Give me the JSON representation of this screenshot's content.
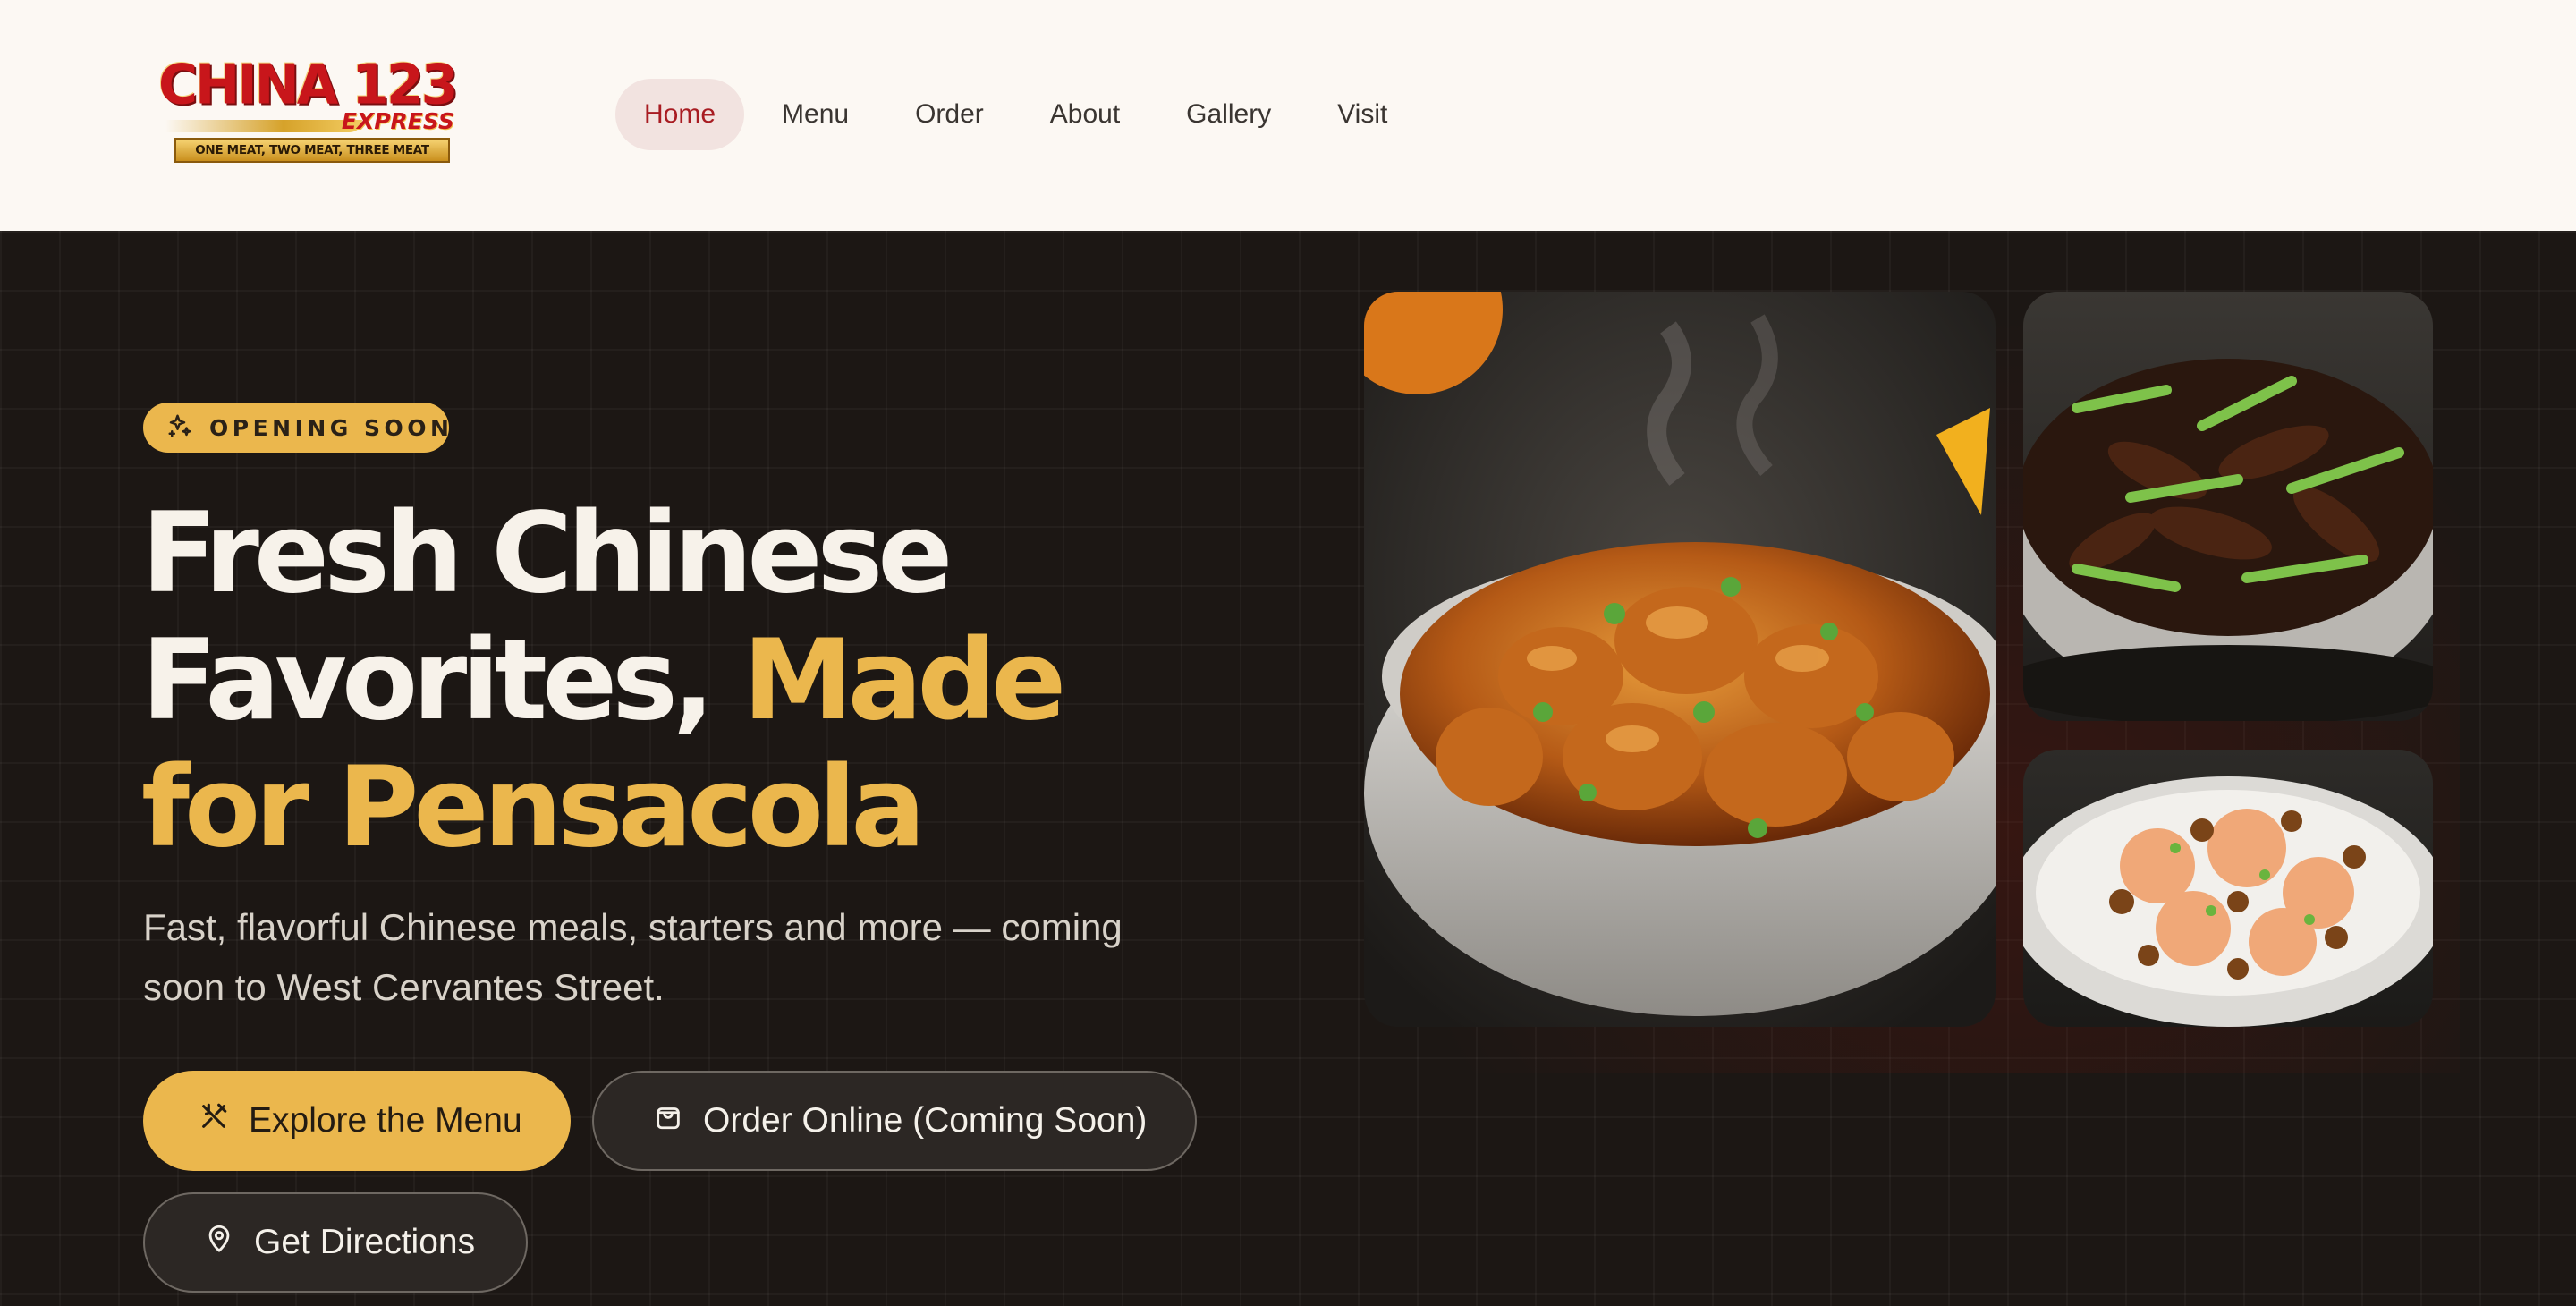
{
  "brand": {
    "logo_main": "CHINA 123",
    "logo_sub": "EXPRESS",
    "logo_tagline": "ONE MEAT, TWO MEAT, THREE MEAT"
  },
  "nav": {
    "items": [
      {
        "label": "Home",
        "active": true
      },
      {
        "label": "Menu",
        "active": false
      },
      {
        "label": "Order",
        "active": false
      },
      {
        "label": "About",
        "active": false
      },
      {
        "label": "Gallery",
        "active": false
      },
      {
        "label": "Visit",
        "active": false
      }
    ]
  },
  "hero": {
    "badge": {
      "icon": "sparkles-icon",
      "text": "OPENING SOON"
    },
    "headline_white": "Fresh Chinese Favorites,",
    "headline_accent": "Made for Pensacola",
    "subtext": "Fast, flavorful Chinese meals, starters and more — coming soon to West Cervantes Street.",
    "buttons": {
      "explore": {
        "icon": "utensils-icon",
        "label": "Explore the Menu"
      },
      "order": {
        "icon": "shopping-bag-icon",
        "label": "Order Online (Coming Soon)"
      },
      "directions": {
        "icon": "map-pin-icon",
        "label": "Get Directions"
      }
    }
  },
  "images": [
    {
      "subject": "orange chicken bowl"
    },
    {
      "subject": "beef with scallions bowl"
    },
    {
      "subject": "honey walnut shrimp plate"
    }
  ],
  "colors": {
    "accent": "#ebb74d",
    "brand_red": "#a81c22",
    "hero_bg": "#1c1714",
    "header_bg": "#fcf8f3"
  }
}
